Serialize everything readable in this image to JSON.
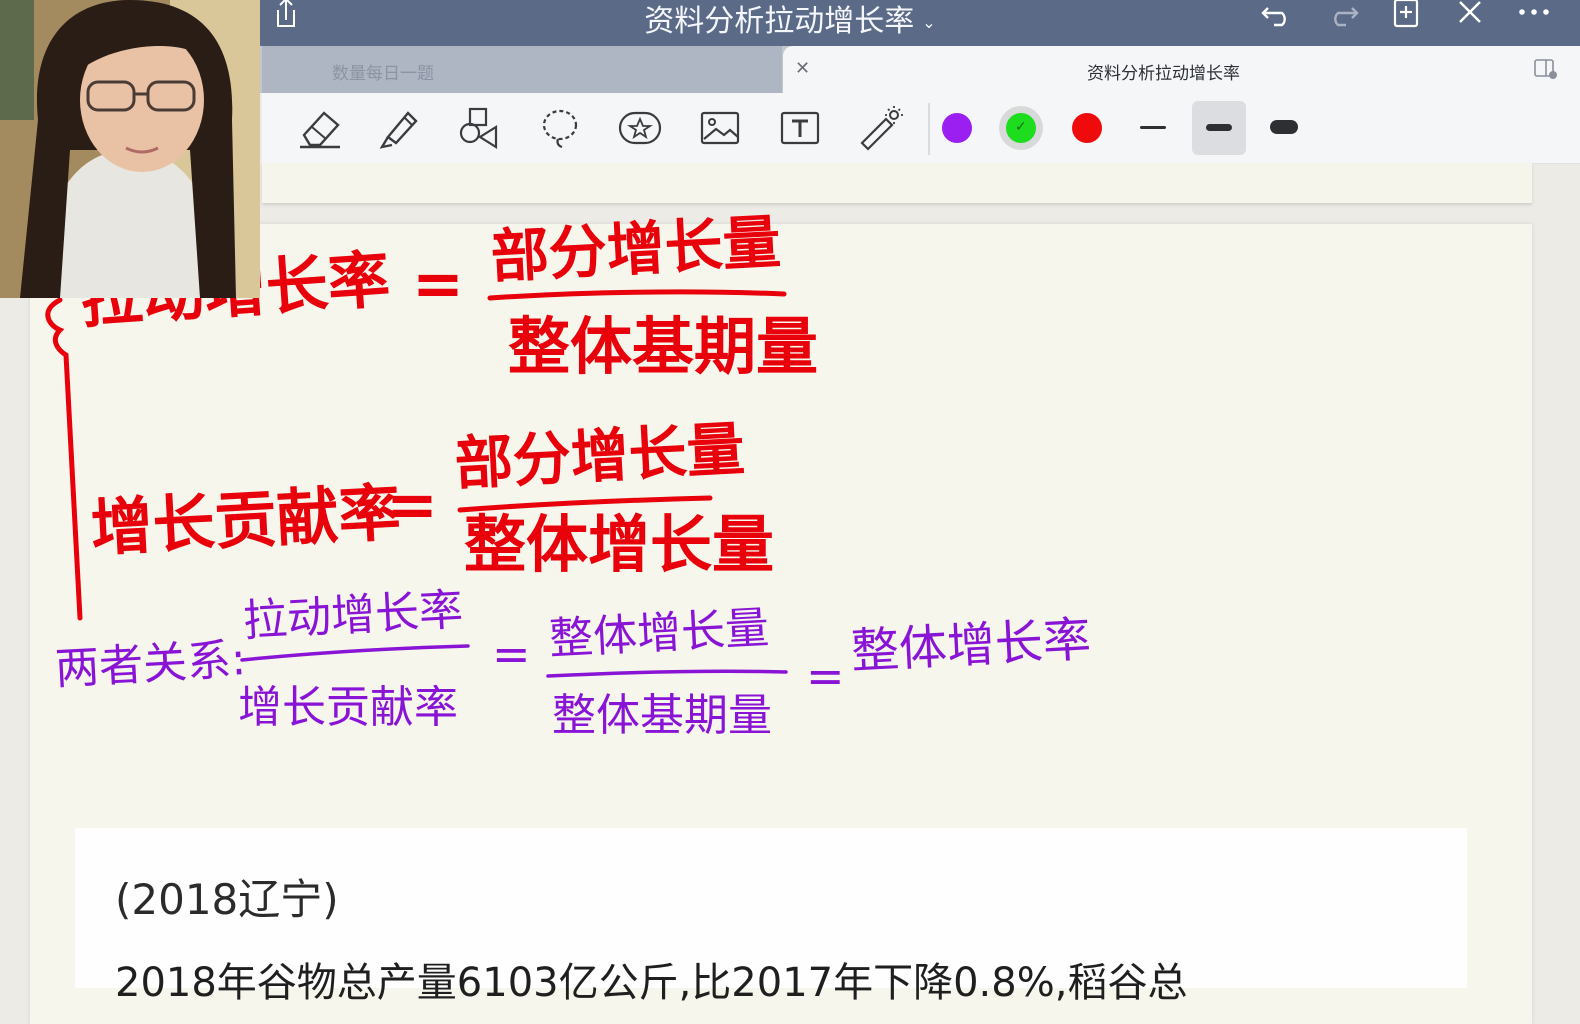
{
  "title_bar": {
    "title": "资料分析拉动增长率",
    "icons": [
      "share-icon",
      "undo-icon",
      "redo-icon",
      "add-page-icon",
      "close-icon",
      "more-icon"
    ]
  },
  "tabs": [
    {
      "label": "数量每日一题",
      "active": false
    },
    {
      "label": "资料分析拉动增长率",
      "active": true
    }
  ],
  "toolbar": {
    "tools": [
      "eraser-icon",
      "highlighter-icon",
      "shapes-icon",
      "lasso-icon",
      "sticker-icon",
      "image-icon",
      "text-icon",
      "laser-pointer-icon"
    ],
    "colors": [
      "#9b1ff0",
      "#1edc1e",
      "#ef0b0b"
    ],
    "selected_color": "#1edc1e",
    "stroke_widths": [
      "thin",
      "medium",
      "thick"
    ],
    "selected_stroke": "medium"
  },
  "handwriting": {
    "red": {
      "formula1_left": "拉动增长率",
      "equals": "=",
      "formula1_numerator": "部分增长量",
      "formula1_denominator": "整体基期量",
      "formula2_left": "增长贡献率",
      "formula2_numerator": "部分增长量",
      "formula2_denominator": "整体增长量"
    },
    "purple": {
      "relation_label": "两者关系:",
      "frac1_numerator": "拉动增长率",
      "frac1_denominator": "增长贡献率",
      "frac2_numerator": "整体增长量",
      "frac2_denominator": "整体基期量",
      "result": "整体增长率"
    }
  },
  "question": {
    "source": "(2018辽宁)",
    "text": "2018年谷物总产量6103亿公斤,比2017年下降0.8%,稻谷总"
  },
  "colors": {
    "title_bar": "#5b6a87",
    "red_ink": "#e8000a",
    "purple_ink": "#8a14d6"
  }
}
